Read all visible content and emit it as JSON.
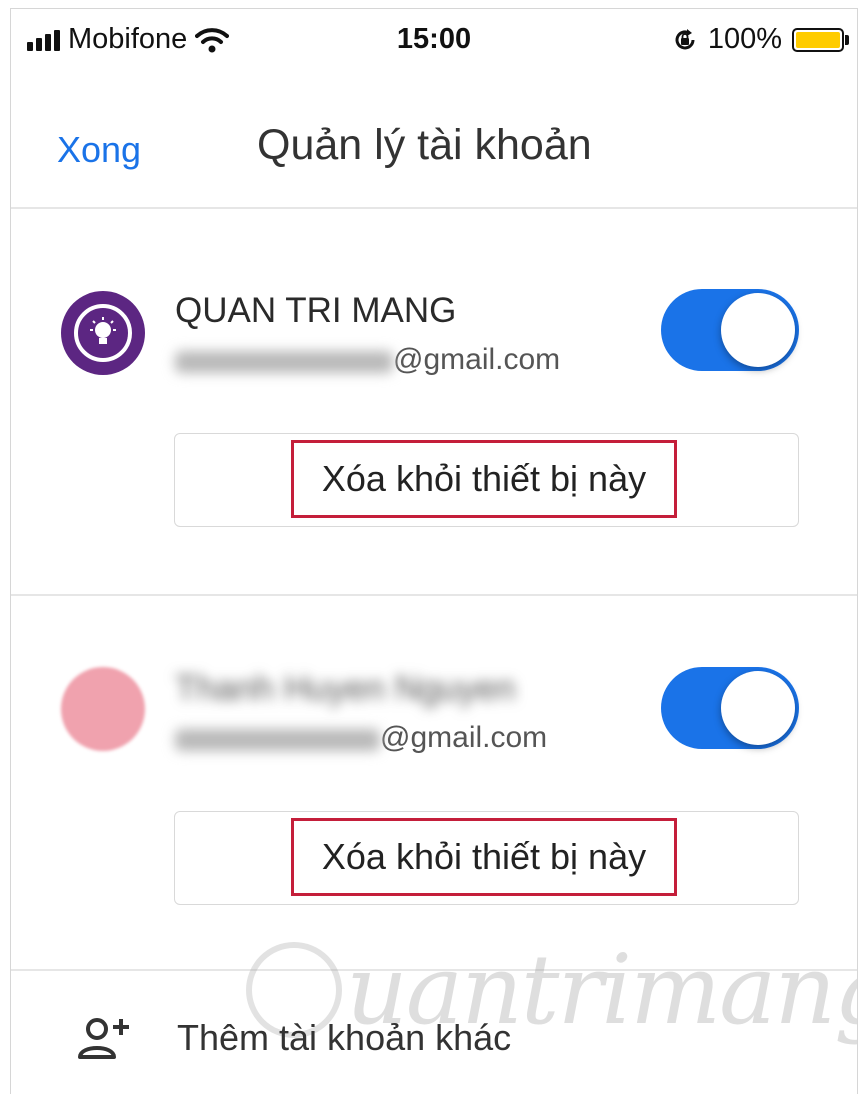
{
  "status_bar": {
    "carrier": "Mobifone",
    "time": "15:00",
    "battery_percent": "100%",
    "battery_level": 1.0,
    "battery_color": "#ffcc00"
  },
  "header": {
    "done_label": "Xong",
    "title": "Quản lý tài khoản"
  },
  "accounts": [
    {
      "name": "QUAN TRI MANG",
      "email_domain": "@gmail.com",
      "toggle_on": true,
      "remove_label": "Xóa khỏi thiết bị này",
      "avatar_color": "#5c2682",
      "avatar_icon": "lightbulb-icon"
    },
    {
      "name": "Thanh Huyen Nguyen",
      "email_domain": "@gmail.com",
      "toggle_on": true,
      "remove_label": "Xóa khỏi thiết bị này",
      "avatar_color": "#f0a2ae"
    }
  ],
  "add_account": {
    "label": "Thêm tài khoản khác",
    "icon": "add-person-icon"
  },
  "watermark": {
    "text": "uantrimang",
    "logo": "lightbulb-icon"
  },
  "colors": {
    "accent": "#1a73e8",
    "highlight_box": "#c41e3a"
  }
}
